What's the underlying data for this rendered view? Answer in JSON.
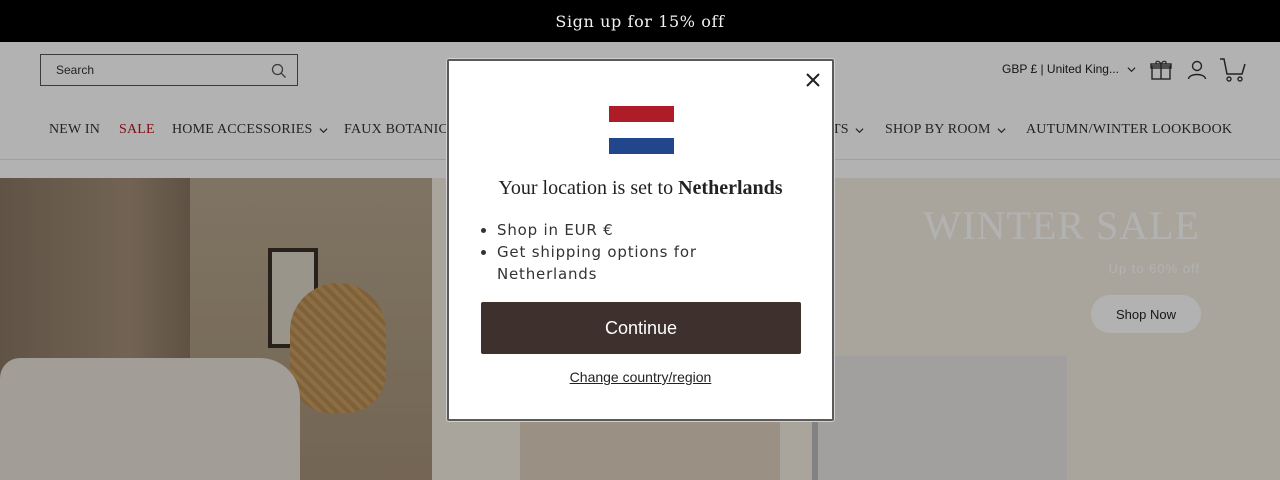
{
  "announcement": {
    "text": "Sign up for 15% off"
  },
  "header": {
    "search": {
      "placeholder": "Search"
    },
    "locale": "GBP £ | United King...",
    "icons": {
      "search": "search-icon",
      "gift": "gift-icon",
      "account": "account-icon",
      "cart": "cart-icon"
    }
  },
  "nav": {
    "items": [
      {
        "label": "NEW IN",
        "dropdown": false
      },
      {
        "label": "SALE",
        "dropdown": false,
        "color": "#b5121b"
      },
      {
        "label": "HOME ACCESSORIES",
        "dropdown": true
      },
      {
        "label": "FAUX BOTANIC",
        "dropdown": false
      },
      {
        "label": "TS",
        "dropdown": true
      },
      {
        "label": "SHOP BY ROOM",
        "dropdown": true
      },
      {
        "label": "AUTUMN/WINTER LOOKBOOK",
        "dropdown": false
      }
    ]
  },
  "hero": {
    "title": "WINTER SALE",
    "subtitle": "Up to 60% off",
    "cta": "Shop Now"
  },
  "modal": {
    "title_prefix": "Your location is set to",
    "country": "Netherlands",
    "bullets": [
      "Shop in EUR €",
      "Get shipping options for Netherlands"
    ],
    "continue_label": "Continue",
    "change_label": "Change country/region",
    "flag_colors": [
      "#ae1c28",
      "#ffffff",
      "#21468b"
    ]
  },
  "colors": {
    "announcement_bg": "#000000",
    "button_bg": "#3d302d",
    "sale_red": "#b5121b"
  }
}
